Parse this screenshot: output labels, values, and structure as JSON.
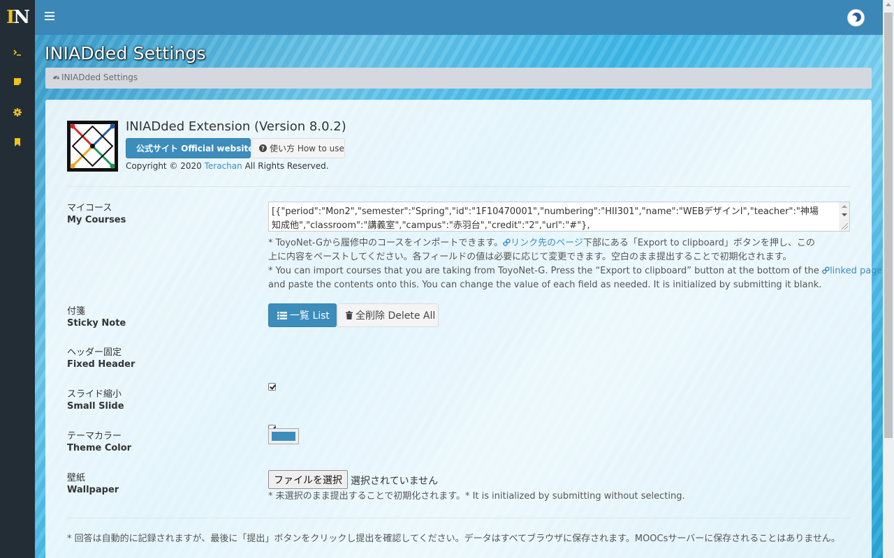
{
  "app": {
    "logo_text": "IN",
    "theme_color": "#3c8dbc"
  },
  "sidebar": {
    "items": [
      {
        "icon": "terminal-icon",
        "color": "#f2c21b"
      },
      {
        "icon": "sticky-note-icon",
        "color": "#f2c21b"
      },
      {
        "icon": "gear-icon",
        "color": "#f2c21b"
      },
      {
        "icon": "bookmark-icon",
        "color": "#f2c21b"
      }
    ]
  },
  "page": {
    "title": "INIADded Settings",
    "breadcrumb": "INIADded Settings"
  },
  "extension": {
    "title": "INIADded Extension (Version 8.0.2)",
    "official_label": "公式サイト Official website",
    "howto_label": "使い方 How to use",
    "copyright_prefix": "Copyright © 2020 ",
    "copyright_author": "Terachan",
    "copyright_suffix": " All Rights Reserved."
  },
  "settings": {
    "my_courses": {
      "label_ja": "マイコース",
      "label_en": "My Courses",
      "value": "[{\"period\":\"Mon2\",\"semester\":\"Spring\",\"id\":\"1F10470001\",\"numbering\":\"HII301\",\"name\":\"WEBデザインⅠ\",\"teacher\":\"神場　知成他\",\"classroom\":\"講義室\",\"campus\":\"赤羽台\",\"credit\":\"2\",\"url\":\"#\"},",
      "help_ja_1a": "* ToyoNet-Gから履修中のコースをインポートできます。",
      "help_ja_link": "リンク先のページ",
      "help_ja_1b": "下部にある「Export to clipboard」ボタンを押し、この",
      "help_ja_2": "上に内容をペーストしてください。各フィールドの値は必要に応じて変更できます。空白のまま提出することで初期化されます。",
      "help_en_1a": "* You can import courses that you are taking from ToyoNet-G. Press the “Export to clipboard” button at the bottom of the ",
      "help_en_link": "linked page",
      "help_en_1b": ",",
      "help_en_2": "and paste the contents onto this. You can change the value of each field as needed. It is initialized by submitting it blank."
    },
    "sticky_note": {
      "label_ja": "付箋",
      "label_en": "Sticky Note",
      "list_label": "一覧 List",
      "delete_label": "全削除 Delete All"
    },
    "fixed_header": {
      "label_ja": "ヘッダー固定",
      "label_en": "Fixed Header",
      "checked": true
    },
    "small_slide": {
      "label_ja": "スライド縮小",
      "label_en": "Small Slide",
      "checked": true
    },
    "theme_color": {
      "label_ja": "テーマカラー",
      "label_en": "Theme Color",
      "value": "#3c8dbc"
    },
    "wallpaper": {
      "label_ja": "壁紙",
      "label_en": "Wallpaper",
      "button_label": "ファイルを選択",
      "status": "選択されていません",
      "help": "* 未選択のまま提出することで初期化されます。* It is initialized by submitting without selecting."
    }
  },
  "footer": {
    "note": "* 回答は自動的に記録されますが、最後に「提出」ボタンをクリックし提出を確認してください。データはすべてブラウザに保存されます。MOOCsサーバーに保存されることはありません。"
  }
}
